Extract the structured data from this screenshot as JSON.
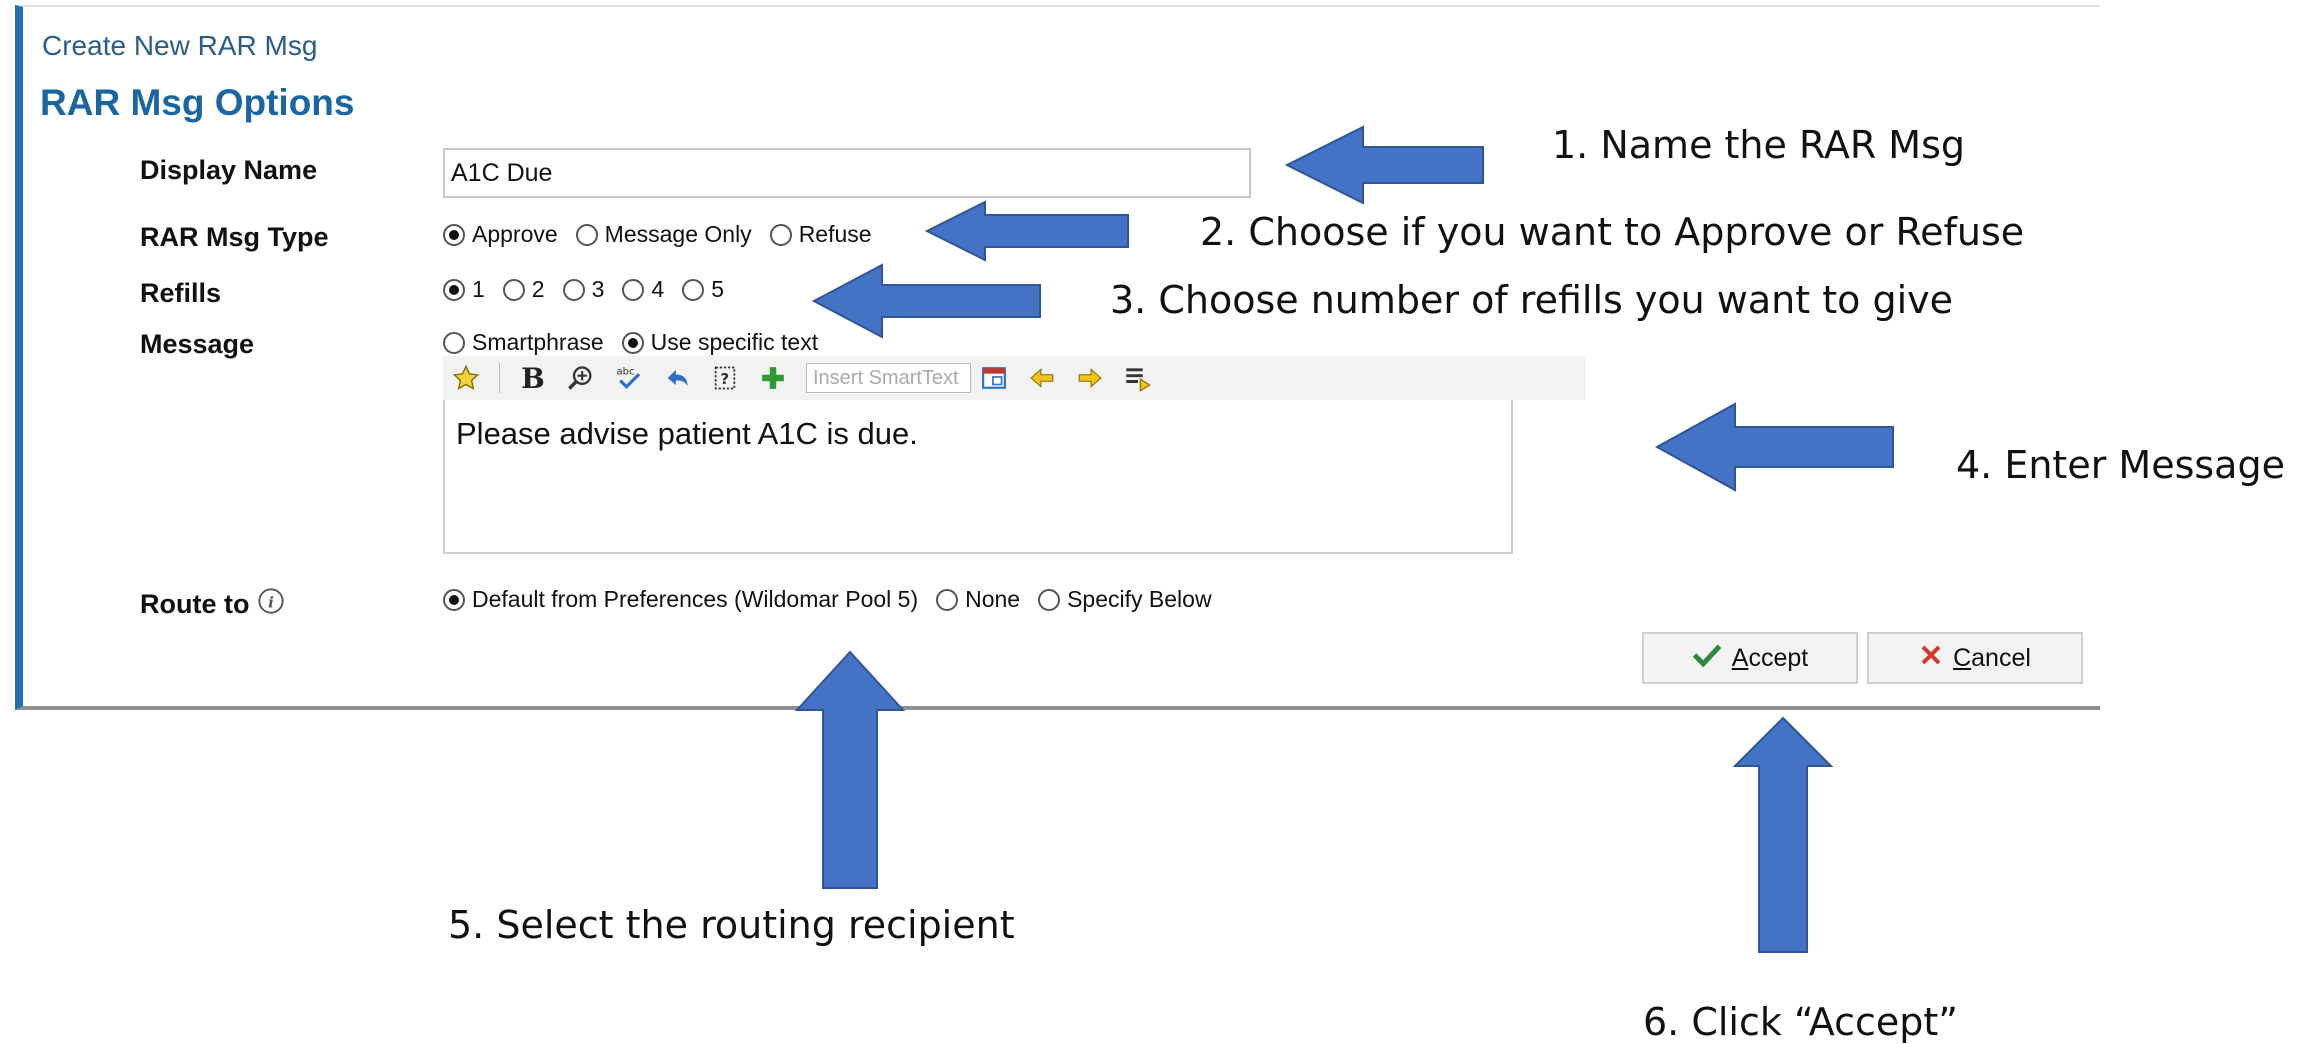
{
  "window": {
    "breadcrumb": "Create New RAR Msg",
    "section_title": "RAR Msg Options"
  },
  "display_name": {
    "label": "Display Name",
    "value": "A1C Due"
  },
  "msg_type": {
    "label": "RAR Msg Type",
    "options": [
      "Approve",
      "Message Only",
      "Refuse"
    ],
    "selected": "Approve"
  },
  "refills": {
    "label": "Refills",
    "options": [
      "1",
      "2",
      "3",
      "4",
      "5"
    ],
    "selected": "1"
  },
  "message": {
    "label": "Message",
    "options": [
      "Smartphrase",
      "Use specific text"
    ],
    "selected": "Use specific text",
    "toolbar": {
      "icons": [
        "star-icon",
        "bold-icon",
        "zoom-icon",
        "spellcheck-icon",
        "undo-icon",
        "help-icon",
        "add-icon",
        "smarttext-picker-icon",
        "arrow-left-icon",
        "arrow-right-icon",
        "insert-list-icon"
      ],
      "smarttext_placeholder": "Insert SmartText"
    },
    "text": "Please advise patient A1C is due."
  },
  "route": {
    "label": "Route to",
    "options": [
      "Default from Preferences (Wildomar Pool 5)",
      "None",
      "Specify Below"
    ],
    "selected": "Default from Preferences (Wildomar Pool 5)"
  },
  "buttons": {
    "accept": {
      "label": "Accept",
      "key": "A"
    },
    "cancel": {
      "label": "Cancel",
      "key": "C"
    }
  },
  "annotations": [
    "1. Name the RAR Msg",
    "2. Choose if you want to Approve or Refuse",
    "3. Choose number of refills you want to give",
    "4. Enter Message",
    "5. Select the routing recipient",
    "6. Click “Accept”"
  ],
  "colors": {
    "accent": "#1f6fb2",
    "arrow": "#4472c4",
    "title": "#1a65a4",
    "accept_check": "#2e8b3a",
    "cancel_x": "#d43a2a"
  }
}
